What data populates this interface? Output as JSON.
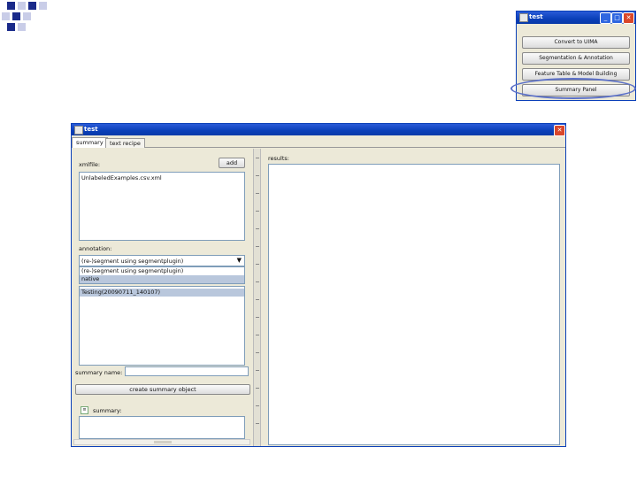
{
  "small_window": {
    "title": "test",
    "buttons": [
      "Convert to UIMA",
      "Segmentation & Annotation",
      "Feature Table & Model Building",
      "Summary Panel"
    ]
  },
  "main_window": {
    "title": "test",
    "tabs": [
      "summary",
      "text recipe"
    ],
    "xmlfile_label": "xmlfile:",
    "add_label": "add",
    "xmlfiles": [
      "UnlabeledExamples.csv.xml"
    ],
    "annotation_label": "annotation:",
    "annotation_selected": "(re-)segment using segmentplugin)",
    "annotation_options": [
      "(re-)segment using segmentplugin)",
      "native"
    ],
    "annotation_list": [
      "Testing(20090711_140107)"
    ],
    "summary_name_label": "summary name:",
    "summary_name_value": "",
    "create_button": "create summary object",
    "summary_label": "summary:",
    "results_label": "results:"
  },
  "colors": {
    "titlebar": "#0a3fb8",
    "window_bg": "#ece9d8",
    "selection": "#b9c7dc",
    "highlight_oval": "#5a6fc8"
  }
}
